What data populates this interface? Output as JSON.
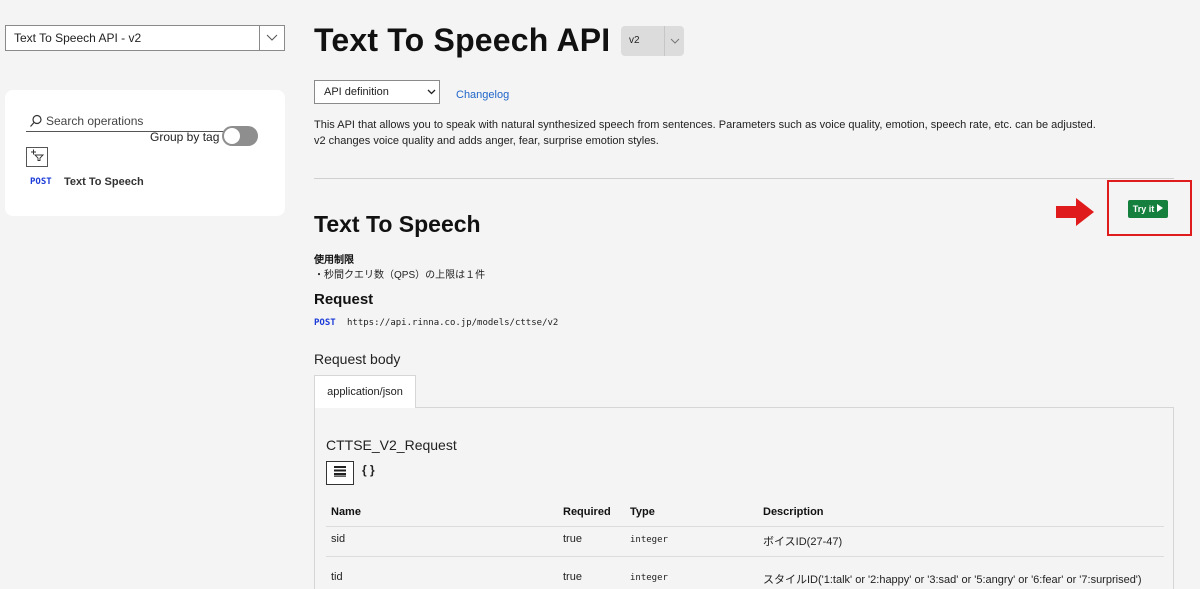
{
  "sidebar": {
    "api_select": "Text To Speech API - v2",
    "search_placeholder": "Search operations",
    "group_by_tag": "Group by tag",
    "operations": [
      {
        "method": "POST",
        "name": "Text To Speech"
      }
    ]
  },
  "header": {
    "title": "Text To Speech API",
    "version": "v2",
    "definition_select": "API definition",
    "changelog": "Changelog",
    "description_lines": [
      "This API that allows you to speak with natural synthesized speech from sentences. Parameters such as voice quality, emotion, speech rate, etc. can be adjusted.",
      "v2 changes voice quality and adds anger, fear, surprise emotion styles."
    ]
  },
  "operation": {
    "title": "Text To Speech",
    "try_it": "Try it",
    "limit_heading": "使用制限",
    "limit_text": "・秒間クエリ数（QPS）の上限は１件",
    "request_heading": "Request",
    "method": "POST",
    "url": "https://api.rinna.co.jp/models/cttse/v2",
    "request_body_heading": "Request body",
    "content_type_tab": "application/json",
    "schema_name": "CTTSE_V2_Request",
    "json_view_label": "{ }",
    "table": {
      "headers": [
        "Name",
        "Required",
        "Type",
        "Description"
      ],
      "rows": [
        {
          "name": "sid",
          "required": "true",
          "type": "integer",
          "description": "ボイスID(27-47)"
        },
        {
          "name": "tid",
          "required": "true",
          "type": "integer",
          "description": "スタイルID('1:talk' or '2:happy' or '3:sad' or '5:angry' or '6:fear' or '7:surprised')"
        }
      ]
    }
  },
  "colors": {
    "accent_link": "#1f66c9",
    "method_post": "#1a3ad9",
    "try_it_bg": "#15803d",
    "highlight": "#e01b1b"
  }
}
